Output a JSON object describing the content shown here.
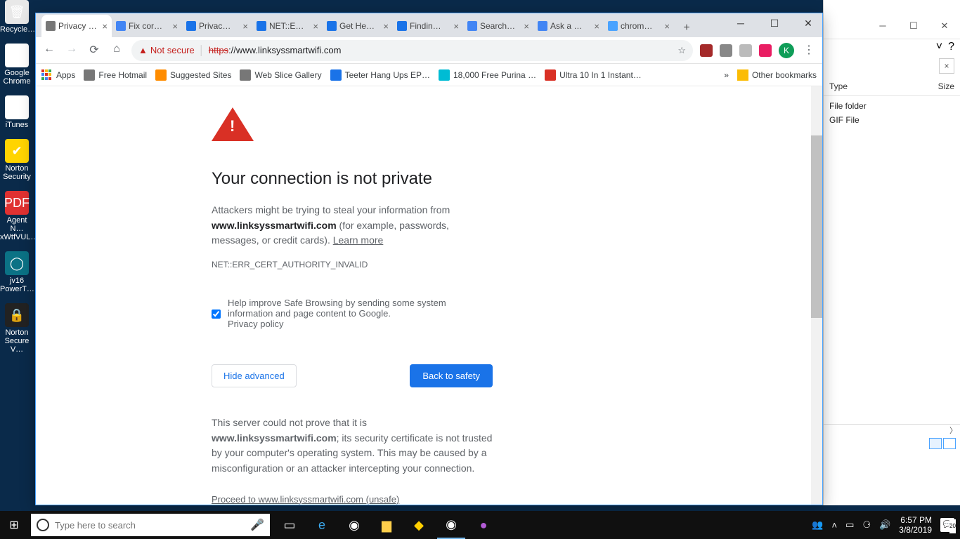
{
  "desktop_icons": [
    {
      "label": "Recycle…",
      "color": "#e8e8e8",
      "glyph": "🗑"
    },
    {
      "label": "Google Chrome",
      "color": "#fff",
      "glyph": "◐"
    },
    {
      "label": "iTunes",
      "color": "#fff",
      "glyph": "♪"
    },
    {
      "label": "Norton Security",
      "color": "#ffd400",
      "glyph": "✔"
    },
    {
      "label": "Agent N… xWtfVUL…",
      "color": "#e03131",
      "glyph": "PDF"
    },
    {
      "label": "jv16 PowerT…",
      "color": "#0b7285",
      "glyph": "◯"
    },
    {
      "label": "Norton Secure V…",
      "color": "#222",
      "glyph": "🔒"
    }
  ],
  "chrome": {
    "tabs": [
      {
        "title": "Privacy err…",
        "active": true,
        "icon": "#777"
      },
      {
        "title": "Fix cor…",
        "icon": "#4285f4"
      },
      {
        "title": "Privac…",
        "icon": "#1a73e8"
      },
      {
        "title": "NET::E…",
        "icon": "#1a73e8"
      },
      {
        "title": "Get He…",
        "icon": "#1a73e8"
      },
      {
        "title": "Findin…",
        "icon": "#1a73e8"
      },
      {
        "title": "Search…",
        "icon": "#4285f4"
      },
      {
        "title": "Ask a …",
        "icon": "#4285f4"
      },
      {
        "title": "chrom…",
        "icon": "#4aa3ff"
      }
    ],
    "nav": {
      "not_secure": "Not secure",
      "url_strike": "https",
      "url_rest": "://www.linksyssmartwifi.com"
    },
    "ext_icons": [
      "star-icon",
      "pdf-icon",
      "help-icon",
      "ext1-icon",
      "ext2-icon"
    ],
    "avatar": "K",
    "bookmarks": [
      {
        "label": "Apps",
        "icon": "#e8710a"
      },
      {
        "label": "Free Hotmail",
        "icon": "#777"
      },
      {
        "label": "Suggested Sites",
        "icon": "#ff8c00"
      },
      {
        "label": "Web Slice Gallery",
        "icon": "#777"
      },
      {
        "label": "Teeter Hang Ups EP…",
        "icon": "#1a73e8"
      },
      {
        "label": "18,000 Free Purina …",
        "icon": "#00bcd4"
      },
      {
        "label": "Ultra 10 In 1 Instant…",
        "icon": "#d93025"
      }
    ],
    "bookmarks_more": "»",
    "other_bookmarks": "Other bookmarks"
  },
  "page": {
    "heading": "Your connection is not private",
    "p1a": "Attackers might be trying to steal your information from ",
    "p1b": "www.linksyssmartwifi.com",
    "p1c": " (for example, passwords, messages, or credit cards). ",
    "learn_more": "Learn more",
    "error_code": "NET::ERR_CERT_AUTHORITY_INVALID",
    "optin_a": "Help improve Safe Browsing by sending some ",
    "optin_link": "system information and page content",
    "optin_b": " to Google. ",
    "privacy": "Privacy policy",
    "hide_advanced": "Hide advanced",
    "back_safety": "Back to safety",
    "d1a": "This server could not prove that it is ",
    "d1b": "www.linksyssmartwifi.com",
    "d1c": "; its security certificate is not trusted by your computer's operating system. This may be caused by a misconfiguration or an attacker intercepting your connection.",
    "proceed": "Proceed to www.linksyssmartwifi.com (unsafe)"
  },
  "explorer": {
    "col_type": "Type",
    "col_size": "Size",
    "rows": [
      "File folder",
      "GIF File"
    ]
  },
  "taskbar": {
    "search_placeholder": "Type here to search",
    "time": "6:57 PM",
    "date": "3/8/2019"
  }
}
